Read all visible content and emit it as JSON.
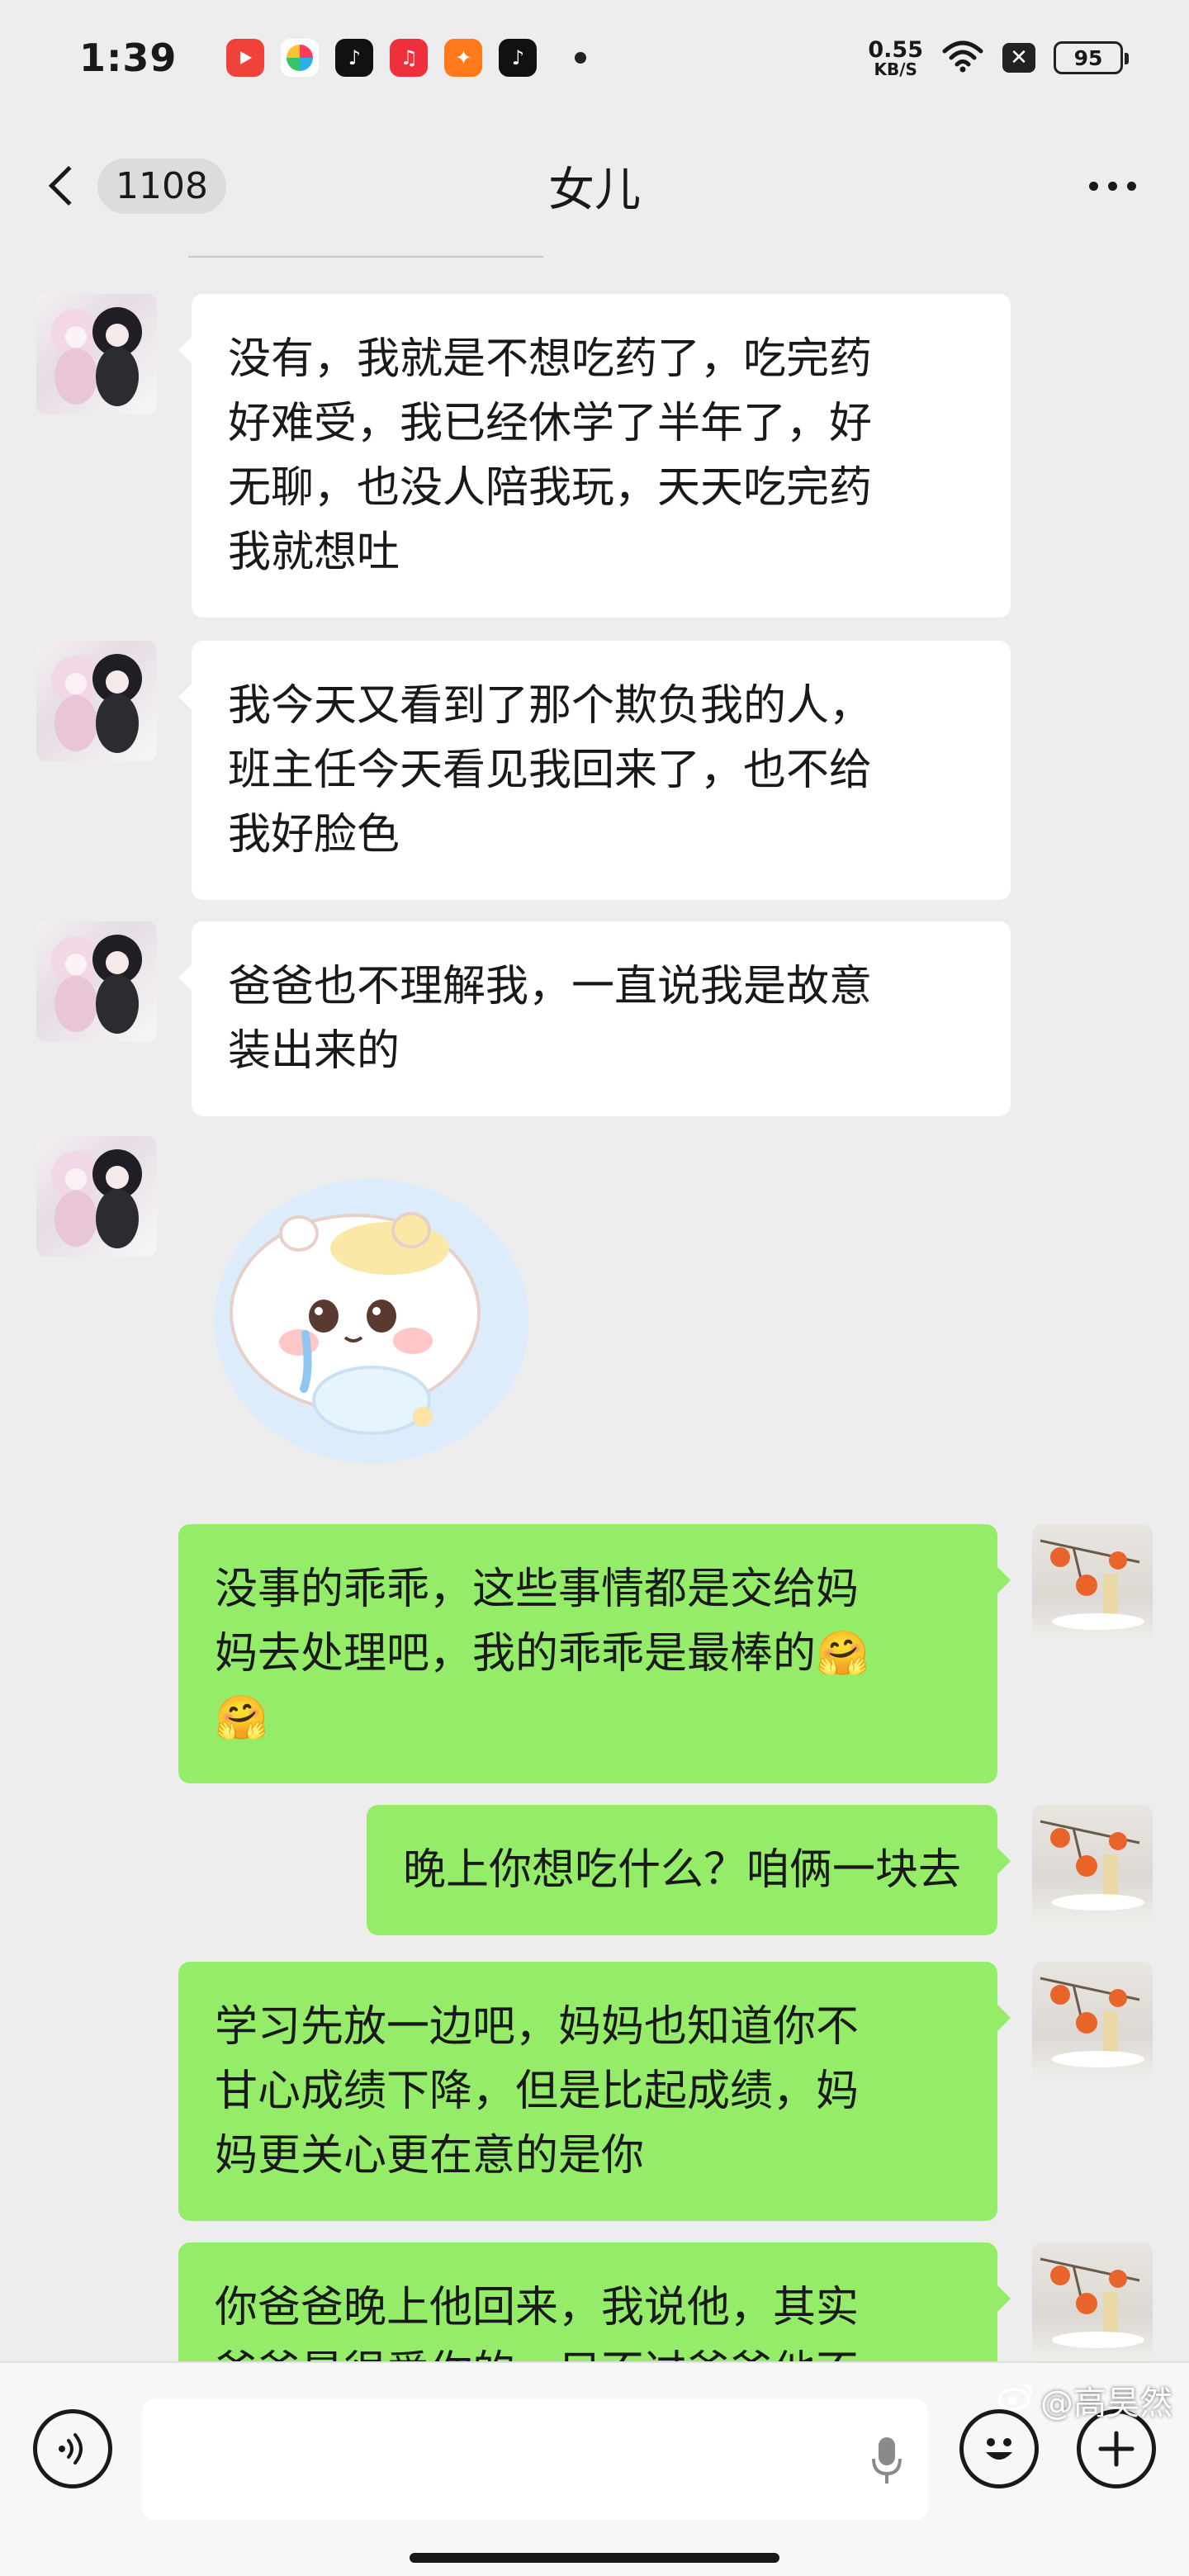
{
  "status_bar": {
    "time": "1:39",
    "net_speed_value": "0.55",
    "net_speed_unit": "KB/S",
    "battery": "95",
    "apps": [
      {
        "icon": "video-app-icon",
        "color": "#f0413b"
      },
      {
        "icon": "pinwheel-app-icon",
        "color": "#2ab0e8"
      },
      {
        "icon": "douyin-lite-app-icon",
        "color": "#111111"
      },
      {
        "icon": "music-app-icon",
        "color": "#ee2f3c"
      },
      {
        "icon": "shopping-app-icon",
        "color": "#ff7a1a"
      },
      {
        "icon": "douyin-app-icon",
        "color": "#111111"
      }
    ]
  },
  "nav": {
    "unread_count": "1108",
    "title": "女儿"
  },
  "messages": [
    {
      "side": "left",
      "type": "text",
      "text": "没有，我就是不想吃药了，吃完药\n好难受，我已经休学了半年了，好\n无聊，也没人陪我玩，天天吃完药\n我就想吐"
    },
    {
      "side": "left",
      "type": "text",
      "text": "我今天又看到了那个欺负我的人，\n班主任今天看见我回来了，也不给\n我好脸色"
    },
    {
      "side": "left",
      "type": "text",
      "text": "爸爸也不理解我，一直说我是故意\n装出来的"
    },
    {
      "side": "left",
      "type": "sticker",
      "sticker": "crying-hamster-sticker"
    },
    {
      "side": "right",
      "type": "text",
      "text": "没事的乖乖，这些事情都是交给妈\n妈去处理吧，我的乖乖是最棒的🤗\n🤗"
    },
    {
      "side": "right",
      "type": "text",
      "text": "晚上你想吃什么？咱俩一块去"
    },
    {
      "side": "right",
      "type": "text",
      "text": "学习先放一边吧，妈妈也知道你不\n甘心成绩下降，但是比起成绩，妈\n妈更关心更在意的是你"
    },
    {
      "side": "right",
      "type": "text",
      "text": "你爸爸晚上他回来，我说他，其实\n爸爸是很爱你的，只不过爸爸他不"
    }
  ],
  "colors": {
    "background": "#ededed",
    "bubble_incoming": "#ffffff",
    "bubble_outgoing": "#95ec69"
  },
  "watermark": "@高昊然"
}
